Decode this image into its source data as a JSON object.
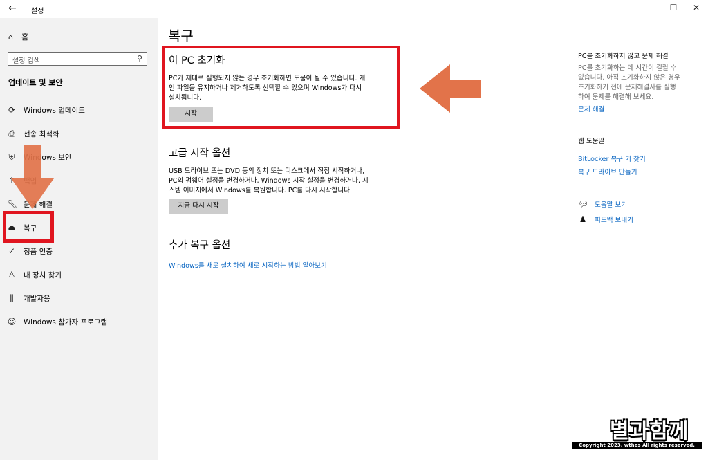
{
  "window": {
    "title": "설정",
    "back_icon": "back-arrow-icon",
    "minimize": "—",
    "maximize": "☐",
    "close": "✕"
  },
  "sidebar": {
    "home": "홈",
    "search_placeholder": "설정 검색",
    "section": "업데이트 및 보안",
    "items": [
      {
        "label": "Windows 업데이트",
        "icon": "sync-icon"
      },
      {
        "label": "전송 최적화",
        "icon": "delivery-icon"
      },
      {
        "label": "Windows 보안",
        "icon": "shield-icon"
      },
      {
        "label": "백업",
        "icon": "backup-icon"
      },
      {
        "label": "문제 해결",
        "icon": "wrench-icon"
      },
      {
        "label": "복구",
        "icon": "recovery-icon"
      },
      {
        "label": "정품 인증",
        "icon": "check-circle-icon"
      },
      {
        "label": "내 장치 찾기",
        "icon": "person-pin-icon"
      },
      {
        "label": "개발자용",
        "icon": "developer-icon"
      },
      {
        "label": "Windows 참가자 프로그램",
        "icon": "insider-icon"
      }
    ]
  },
  "main": {
    "title": "복구",
    "reset": {
      "heading": "이 PC 초기화",
      "line1": "PC가 제대로 실행되지 않는 경우 초기화하면 도움이 될 수 있습니다. 개",
      "line2": "인 파일을 유지하거나 제거하도록 선택할 수 있으며 Windows가 다시",
      "line3": "설치됩니다.",
      "button": "시작"
    },
    "advanced": {
      "heading": "고급 시작 옵션",
      "line1": "USB 드라이브 또는 DVD 등의 장치 또는 디스크에서 직접 시작하거나,",
      "line2": "PC의 펌웨어 설정을 변경하거나, Windows 시작 설정을 변경하거나, 시",
      "line3": "스템 이미지에서 Windows를 복원합니다. PC를 다시 시작합니다.",
      "button": "지금 다시 시작"
    },
    "more": {
      "heading": "추가 복구 옵션",
      "link": "Windows를 새로 설치하여 새로 시작하는 방법 알아보기"
    }
  },
  "right": {
    "fix_heading": "PC를 초기화하지 않고 문제 해결",
    "fix_line1": "PC를 초기화하는 데 시간이 걸릴 수",
    "fix_line2": "있습니다. 아직 초기화하지 않은 경우",
    "fix_line3": "초기화하기 전에 문제해결사를 실행",
    "fix_line4": "하여 문제를 해결해 보세요.",
    "fix_link": "문제 해결",
    "web_help": "웹 도움말",
    "bitlocker_link": "BitLocker 복구 키 찾기",
    "drive_link": "복구 드라이브 만들기",
    "help": "도움말 보기",
    "feedback": "피드백 보내기"
  },
  "watermark": {
    "brand": "별과함께",
    "copyright": "Copyright 2023. wthes All rights reserved."
  },
  "colors": {
    "highlight": "#e0151f",
    "arrow": "#e2734a",
    "link": "#0a66c2",
    "sidebar": "#f2f2f2"
  }
}
